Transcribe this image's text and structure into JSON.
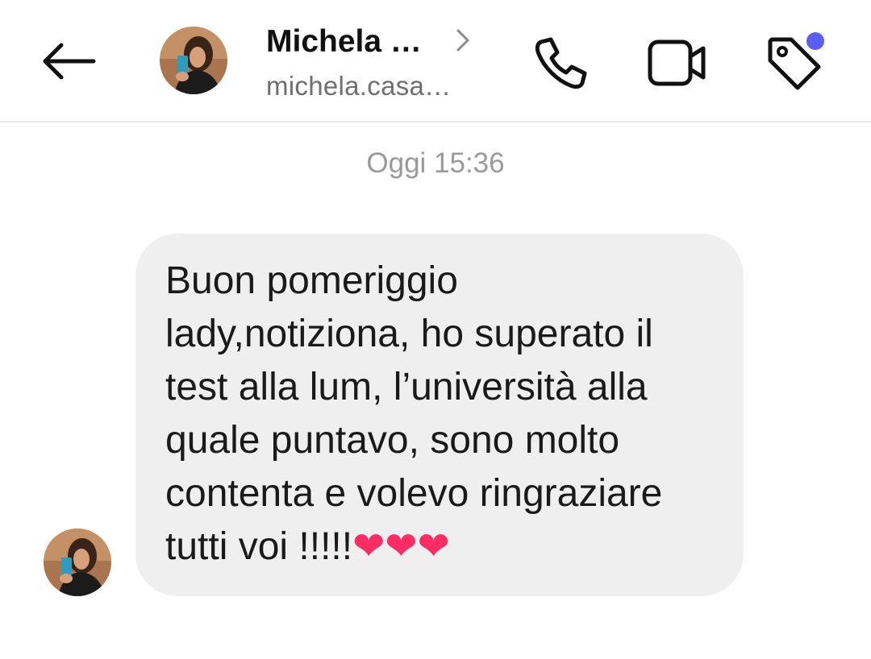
{
  "header": {
    "back_icon": "arrow-left-icon",
    "contact_name": "Michela …",
    "contact_username": "michela.casa…",
    "chevron_icon": "chevron-right-icon",
    "call_icon": "phone-icon",
    "video_icon": "video-camera-icon",
    "tag_icon": "tag-icon",
    "notification_dot_color": "#5b5ff0"
  },
  "thread": {
    "timestamp": "Oggi 15:36",
    "messages": [
      {
        "sender": "Michela …",
        "text": "Buon pomeriggio\nlady,notiziona, ho superato il\ntest alla lum, l’università alla\nquale puntavo, sono molto\ncontenta e volevo ringraziare\ntutti voi !!!!!",
        "emoji": "❤❤❤",
        "bubble_color": "#efefef"
      }
    ]
  },
  "colors": {
    "background": "#ffffff",
    "timestamp": "#9a9a9a",
    "username": "#6f6f6f"
  }
}
